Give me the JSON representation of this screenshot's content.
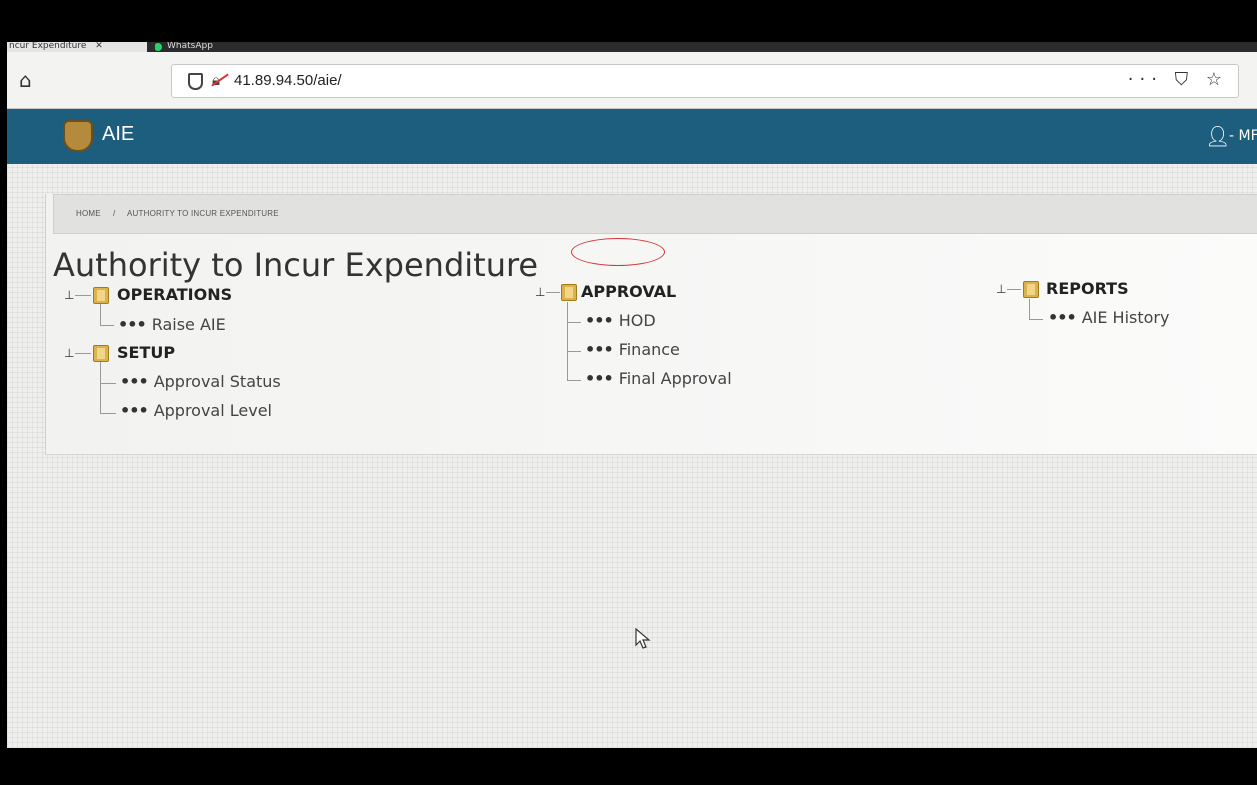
{
  "browser": {
    "tab_active": "ncur Expenditure",
    "tab_active_close": "✕",
    "tab_second": "WhatsApp",
    "url": "41.89.94.50/aie/",
    "url_actions": "··· ⛉ ☆"
  },
  "app": {
    "title": "AIE",
    "user": "- MF"
  },
  "breadcrumb": {
    "home": "HOME",
    "separator": "/",
    "current": "AUTHORITY TO INCUR EXPENDITURE"
  },
  "page_title": "Authority to Incur Expenditure",
  "groups": {
    "operations": {
      "label": "OPERATIONS",
      "items": [
        "Raise AIE"
      ]
    },
    "setup": {
      "label": "SETUP",
      "items": [
        "Approval Status",
        "Approval Level"
      ]
    },
    "approval": {
      "label": "APPROVAL",
      "items": [
        "HOD",
        "Finance",
        "Final Approval"
      ]
    },
    "reports": {
      "label": "REPORTS",
      "items": [
        "AIE History"
      ]
    }
  },
  "leaf_prefix": "•••",
  "colors": {
    "header_blue": "#1d5d7e",
    "folder": "#dcb24b",
    "annotation_red": "#d3363a"
  }
}
